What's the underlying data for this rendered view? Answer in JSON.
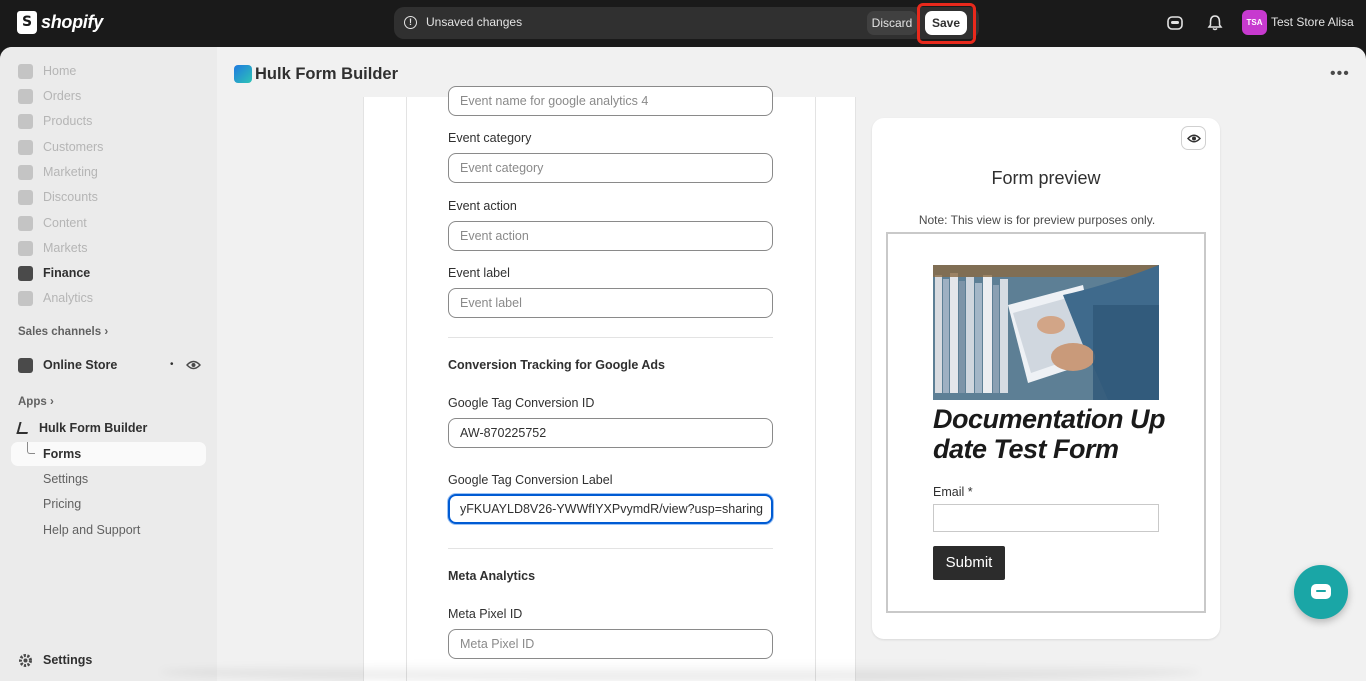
{
  "topbar": {
    "brand": "shopify",
    "unsaved_message": "Unsaved changes",
    "discard_label": "Discard",
    "save_label": "Save",
    "avatar_initials": "TSA",
    "store_name": "Test Store Alisa",
    "avatar_color": "#c73acf",
    "highlight_color": "#e8291c"
  },
  "sidebar": {
    "items": [
      {
        "label": "Home",
        "icon": "home-icon"
      },
      {
        "label": "Orders",
        "icon": "orders-icon"
      },
      {
        "label": "Products",
        "icon": "tag-icon"
      },
      {
        "label": "Customers",
        "icon": "person-icon"
      },
      {
        "label": "Marketing",
        "icon": "marketing-icon"
      },
      {
        "label": "Discounts",
        "icon": "discount-icon"
      },
      {
        "label": "Content",
        "icon": "content-icon"
      },
      {
        "label": "Markets",
        "icon": "globe-icon"
      },
      {
        "label": "Finance",
        "icon": "bank-icon"
      },
      {
        "label": "Analytics",
        "icon": "chart-icon"
      }
    ],
    "sales_channels_label": "Sales channels",
    "online_store_label": "Online Store",
    "apps_label": "Apps",
    "app_name": "Hulk Form Builder",
    "app_sub_items": [
      "Forms",
      "Settings",
      "Pricing",
      "Help and Support"
    ],
    "settings_label": "Settings"
  },
  "main": {
    "app_title": "Hulk Form Builder",
    "fields": {
      "ga4_event_placeholder": "Event name for google analytics 4",
      "event_category_label": "Event category",
      "event_category_placeholder": "Event category",
      "event_action_label": "Event action",
      "event_action_placeholder": "Event action",
      "event_label_label": "Event label",
      "event_label_placeholder": "Event label",
      "google_ads_heading": "Conversion Tracking for Google Ads",
      "conversion_id_label": "Google Tag Conversion ID",
      "conversion_id_value": "AW-870225752",
      "conversion_label_label": "Google Tag Conversion Label",
      "conversion_label_value": "yFKUAYLD8V26-YWWfIYXPvymdR/view?usp=sharing",
      "meta_heading": "Meta Analytics",
      "meta_pixel_label": "Meta Pixel ID",
      "meta_pixel_placeholder": "Meta Pixel ID"
    }
  },
  "preview": {
    "title": "Form preview",
    "note": "Note: This view is for preview purposes only.",
    "form_title": "Documentation Up date Test Form",
    "email_label": "Email *",
    "submit_label": "Submit"
  }
}
